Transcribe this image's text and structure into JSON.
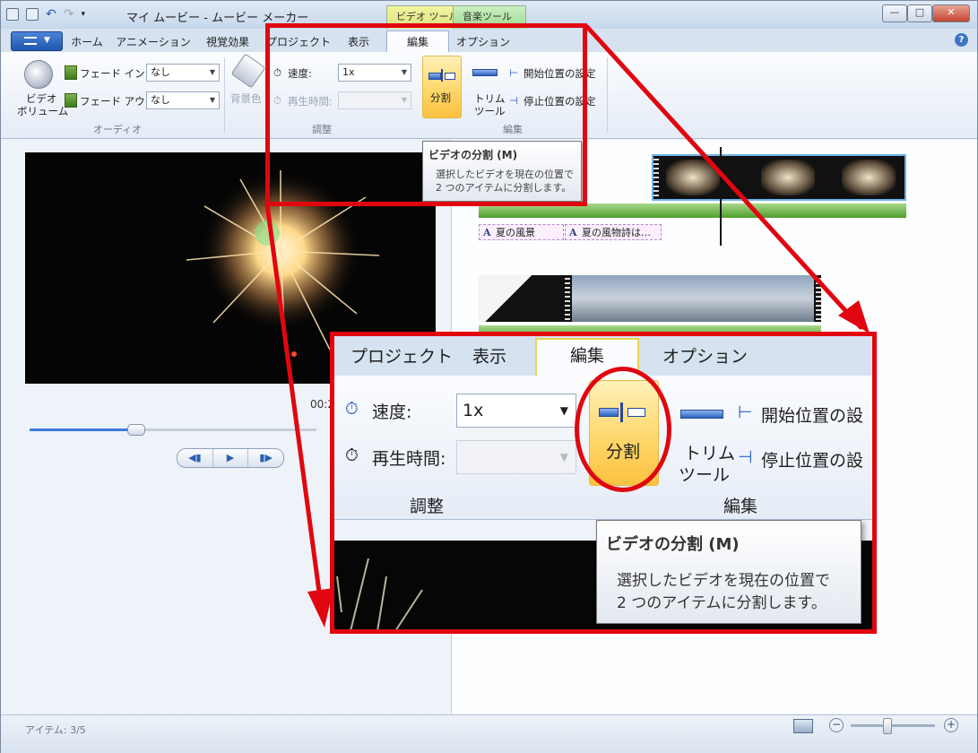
{
  "window": {
    "title": "マイ ムービー - ムービー メーカー",
    "context_tabs": {
      "video_tools": "ビデオ ツール",
      "music_tools": "音楽ツール"
    },
    "controls": {
      "minimize": "—",
      "maximize": "□",
      "close": "✕"
    }
  },
  "ribbon_tabs": [
    "ホーム",
    "アニメーション",
    "視覚効果",
    "プロジェクト",
    "表示",
    "編集",
    "オプション"
  ],
  "active_tab": "編集",
  "audio_group": {
    "volume_label_1": "ビデオ",
    "volume_label_2": "ボリューム",
    "fade_in_label": "フェード イン:",
    "fade_in_value": "なし",
    "fade_out_label": "フェード アウト:",
    "fade_out_value": "なし",
    "group_label": "オーディオ"
  },
  "background": {
    "label": "背景色"
  },
  "adjust_group": {
    "speed_label": "速度:",
    "speed_value": "1x",
    "duration_label": "再生時間:",
    "duration_value": "",
    "group_label": "調整"
  },
  "edit_group": {
    "split_label": "分割",
    "trim_label_1": "トリム",
    "trim_label_2": "ツール",
    "set_start": "開始位置の設定",
    "set_end": "停止位置の設定",
    "group_label": "編集"
  },
  "tooltip": {
    "title": "ビデオの分割 (M)",
    "line1": "選択したビデオを現在の位置で",
    "line2": "2 つのアイテムに分割します。"
  },
  "player": {
    "timecode": "00:2"
  },
  "captions": [
    "夏の風景",
    "夏の風物詩は…"
  ],
  "status": {
    "items": "アイテム: 3/5"
  },
  "zoom": {
    "tabs": [
      "プロジェクト",
      "表示",
      "編集",
      "オプション"
    ],
    "speed_label": "速度:",
    "speed_value": "1x",
    "duration_label": "再生時間:",
    "adjust_label": "調整",
    "split_label": "分割",
    "trim_label_1": "トリム",
    "trim_label_2": "ツール",
    "set_start": "開始位置の設",
    "set_end": "停止位置の設",
    "edit_label": "編集",
    "tooltip_title": "ビデオの分割 (M)",
    "tooltip_line1": "選択したビデオを現在の位置で",
    "tooltip_line2": "2 つのアイテムに分割します。"
  },
  "colors": {
    "highlight_red": "#e1060f",
    "accent_blue": "#2d62c1",
    "button_gold": "#fbc23f"
  }
}
